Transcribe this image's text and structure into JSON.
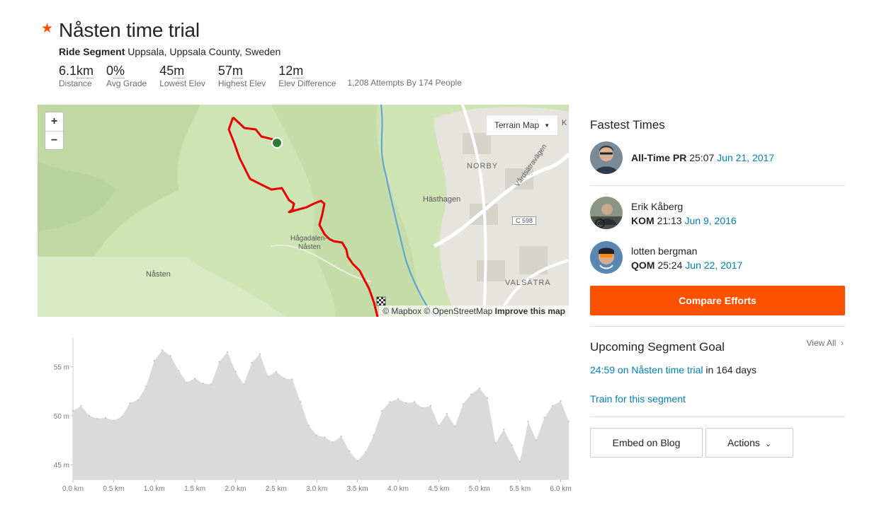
{
  "segment": {
    "title": "Nåsten time trial",
    "type_label": "Ride Segment",
    "location": "Uppsala, Uppsala County, Sweden"
  },
  "stats": [
    {
      "num": "6.1",
      "unit": "km",
      "label": "Distance"
    },
    {
      "num": "0",
      "unit": "%",
      "label": "Avg Grade"
    },
    {
      "num": "45",
      "unit": "m",
      "label": "Lowest Elev"
    },
    {
      "num": "57",
      "unit": "m",
      "label": "Highest Elev"
    },
    {
      "num": "12",
      "unit": "m",
      "label": "Elev Difference"
    }
  ],
  "attempts": "1,208 Attempts By 174 People",
  "map": {
    "zoom_in": "+",
    "zoom_out": "−",
    "map_type": "Terrain Map",
    "attribution_text": "© Mapbox © OpenStreetMap",
    "improve_link": "Improve this map",
    "places": [
      "NORBY",
      "Hästhagen",
      "Vårdsätravägen",
      "C 598",
      "Hågadalen-",
      "Nåsten",
      "Nåsten",
      "VALSÄTRA",
      "K"
    ]
  },
  "elevation": {
    "y_ticks": [
      "55 m",
      "50 m",
      "45 m"
    ],
    "x_ticks": [
      "0.0 km",
      "0.5 km",
      "1.0 km",
      "1.5 km",
      "2.0 km",
      "2.5 km",
      "3.0 km",
      "3.5 km",
      "4.0 km",
      "4.5 km",
      "5.0 km",
      "5.5 km",
      "6.0 km"
    ]
  },
  "chart_data": {
    "type": "area",
    "xlabel": "",
    "ylabel": "",
    "xlim": [
      0,
      6.1
    ],
    "ylim": [
      43.5,
      58
    ],
    "x": [
      0.0,
      0.1,
      0.2,
      0.3,
      0.4,
      0.5,
      0.6,
      0.7,
      0.8,
      0.9,
      1.0,
      1.1,
      1.2,
      1.3,
      1.4,
      1.5,
      1.6,
      1.7,
      1.8,
      1.9,
      2.0,
      2.1,
      2.2,
      2.3,
      2.4,
      2.5,
      2.6,
      2.7,
      2.8,
      2.9,
      3.0,
      3.1,
      3.2,
      3.3,
      3.4,
      3.5,
      3.6,
      3.7,
      3.8,
      3.9,
      4.0,
      4.1,
      4.2,
      4.3,
      4.4,
      4.5,
      4.6,
      4.7,
      4.8,
      4.9,
      5.0,
      5.1,
      5.2,
      5.3,
      5.4,
      5.5,
      5.6,
      5.7,
      5.8,
      5.9,
      6.0,
      6.1
    ],
    "values": [
      50.5,
      51.0,
      50.0,
      49.7,
      49.8,
      49.5,
      49.9,
      51.3,
      51.6,
      53.0,
      55.6,
      56.7,
      56.1,
      54.6,
      53.4,
      53.8,
      53.3,
      53.2,
      55.5,
      56.5,
      54.5,
      53.2,
      55.4,
      56.3,
      54.0,
      54.5,
      53.8,
      53.7,
      51.4,
      49.0,
      48.0,
      47.8,
      47.3,
      47.9,
      46.4,
      45.4,
      46.3,
      48.0,
      50.5,
      51.4,
      51.7,
      51.3,
      51.4,
      50.8,
      51.0,
      49.0,
      50.2,
      48.9,
      51.2,
      52.2,
      52.8,
      51.8,
      47.2,
      48.6,
      47.0,
      45.3,
      49.4,
      47.5,
      49.8,
      51.0,
      51.5,
      49.4
    ]
  },
  "sidebar": {
    "fastest_heading": "Fastest Times",
    "pr": {
      "label": "All-Time PR",
      "time": "25:07",
      "date": "Jun 21, 2017"
    },
    "kom": {
      "name": "Erik Kåberg",
      "label": "KOM",
      "time": "21:13",
      "date": "Jun 9, 2016"
    },
    "qom": {
      "name": "lotten bergman",
      "label": "QOM",
      "time": "25:24",
      "date": "Jun 22, 2017"
    },
    "compare_label": "Compare Efforts",
    "goal_heading": "Upcoming Segment Goal",
    "view_all": "View All",
    "goal_link": "24:59 on Nåsten time trial",
    "goal_suffix": "in 164 days",
    "train_link": "Train for this segment",
    "embed_label": "Embed on Blog",
    "actions_label": "Actions"
  },
  "colors": {
    "brand": "#fc5200",
    "link": "#007fb6",
    "route": "#e80000",
    "map_green": "#cfe4b4",
    "elevation_fill": "#dadada"
  }
}
